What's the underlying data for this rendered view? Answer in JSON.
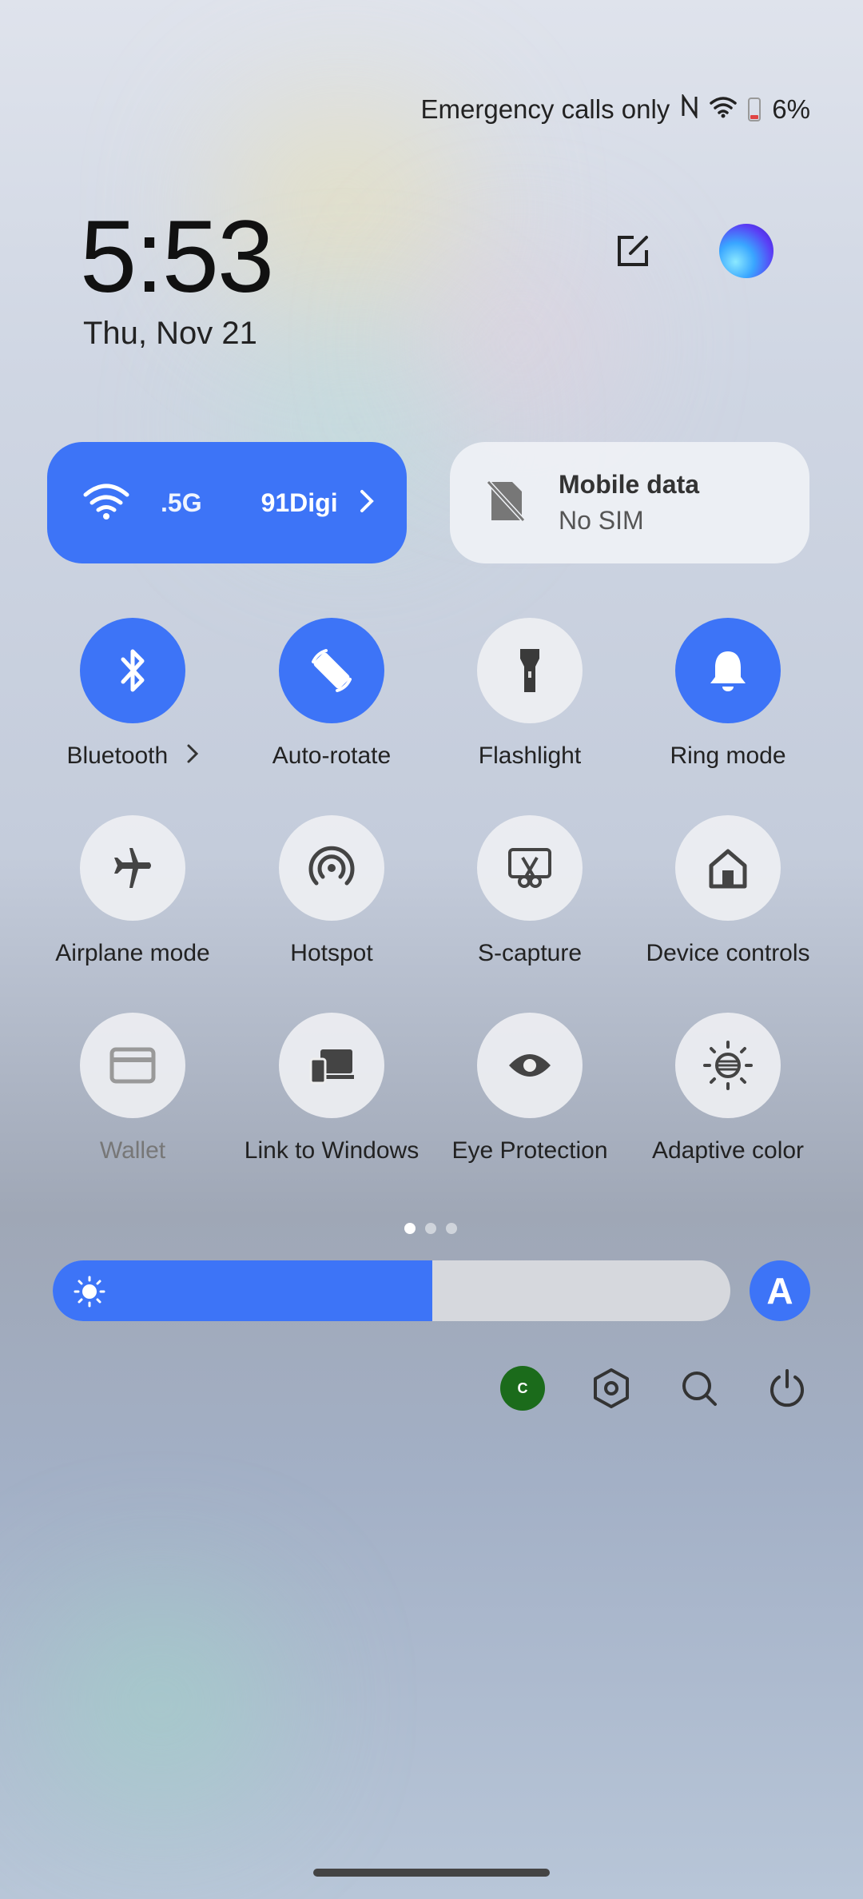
{
  "status_bar": {
    "carrier_text": "Emergency calls only",
    "battery_percent": "6%"
  },
  "header": {
    "time": "5:53",
    "date": "Thu, Nov 21",
    "edit_icon": "edit-icon",
    "assistant_icon": "assistant-orb-icon"
  },
  "wifi_card": {
    "ssid_part1": ".5G",
    "ssid_part2": "91Digi",
    "icon": "wifi-icon",
    "color": "#3d74f7"
  },
  "mobile_card": {
    "title": "Mobile data",
    "subtitle": "No SIM",
    "icon": "no-sim-icon"
  },
  "tiles": [
    {
      "label": "Bluetooth",
      "icon": "bluetooth-icon",
      "active": true
    },
    {
      "label": "Auto-rotate",
      "icon": "rotate-icon",
      "active": true
    },
    {
      "label": "Flashlight",
      "icon": "flashlight-icon",
      "active": false
    },
    {
      "label": "Ring mode",
      "icon": "bell-icon",
      "active": true
    },
    {
      "label": "Airplane mode",
      "icon": "airplane-icon",
      "active": false
    },
    {
      "label": "Hotspot",
      "icon": "hotspot-icon",
      "active": false
    },
    {
      "label": "S-capture",
      "icon": "scissors-icon",
      "active": false
    },
    {
      "label": "Device controls",
      "icon": "home-icon",
      "active": false
    },
    {
      "label": "Wallet",
      "icon": "wallet-icon",
      "active": false
    },
    {
      "label": "Link to Windows",
      "icon": "link-devices-icon",
      "active": false
    },
    {
      "label": "Eye Protection",
      "icon": "eye-icon",
      "active": false
    },
    {
      "label": "Adaptive color",
      "icon": "adaptive-color-icon",
      "active": false
    }
  ],
  "page_indicator": {
    "current": 1,
    "total": 3
  },
  "brightness": {
    "level_percent": 56,
    "auto_label": "A"
  },
  "bottom_icons": {
    "avatar_letter": "C",
    "icons": [
      "account-avatar",
      "settings-icon",
      "search-icon",
      "power-icon"
    ]
  }
}
